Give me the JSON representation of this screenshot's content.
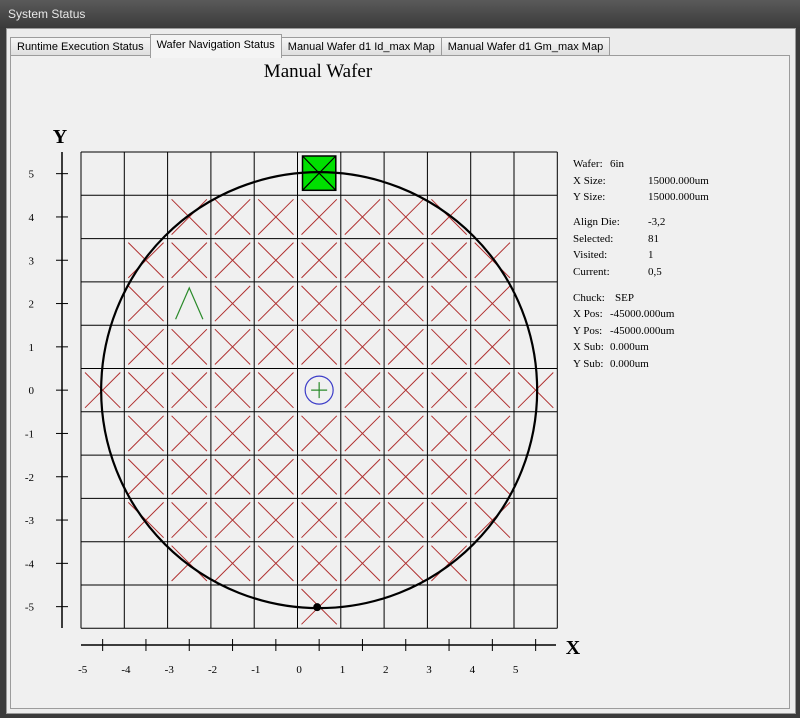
{
  "window": {
    "title": "System Status"
  },
  "tabs": [
    {
      "label": "Runtime Execution Status"
    },
    {
      "label": "Wafer Navigation Status"
    },
    {
      "label": "Manual Wafer d1 Id_max Map"
    },
    {
      "label": "Manual Wafer d1 Gm_max Map"
    }
  ],
  "active_tab": 1,
  "map": {
    "title": "Manual Wafer",
    "y_axis_label": "Y",
    "x_axis_label": "X",
    "x_ticks": [
      "-5",
      "-4",
      "-3",
      "-2",
      "-1",
      "0",
      "1",
      "2",
      "3",
      "4",
      "5"
    ],
    "y_ticks": [
      "5",
      "4",
      "3",
      "2",
      "1",
      "0",
      "-1",
      "-2",
      "-3",
      "-4",
      "-5"
    ],
    "colors": {
      "grid": "#000000",
      "visited_die": "#00e000",
      "excluded_mark": "#b03030",
      "current_mark": "#2a8a2a",
      "center_marker": "#3c3cc8",
      "align_marker": "#2a8a2a"
    },
    "selected_die": {
      "x": 0,
      "y": 5
    },
    "align_die": {
      "x": -3,
      "y": 2
    },
    "center_die": {
      "x": 0,
      "y": 0
    },
    "notch": "bottom"
  },
  "info": {
    "wafer_label": "Wafer:",
    "wafer_value": "6in",
    "xsize_label": "X Size:",
    "xsize_value": "15000.000um",
    "ysize_label": "Y Size:",
    "ysize_value": "15000.000um",
    "align_label": "Align Die:",
    "align_value": "-3,2",
    "selected_label": "Selected:",
    "selected_value": "81",
    "visited_label": "Visited:",
    "visited_value": "1",
    "current_label": "Current:",
    "current_value": "0,5",
    "chuck_label": "Chuck:",
    "chuck_value": "SEP",
    "xpos_label": "X Pos:",
    "xpos_value": "-45000.000um",
    "ypos_label": "Y Pos:",
    "ypos_value": "-45000.000um",
    "xsub_label": "X Sub:",
    "xsub_value": "0.000um",
    "ysub_label": "Y Sub:",
    "ysub_value": "0.000um"
  }
}
